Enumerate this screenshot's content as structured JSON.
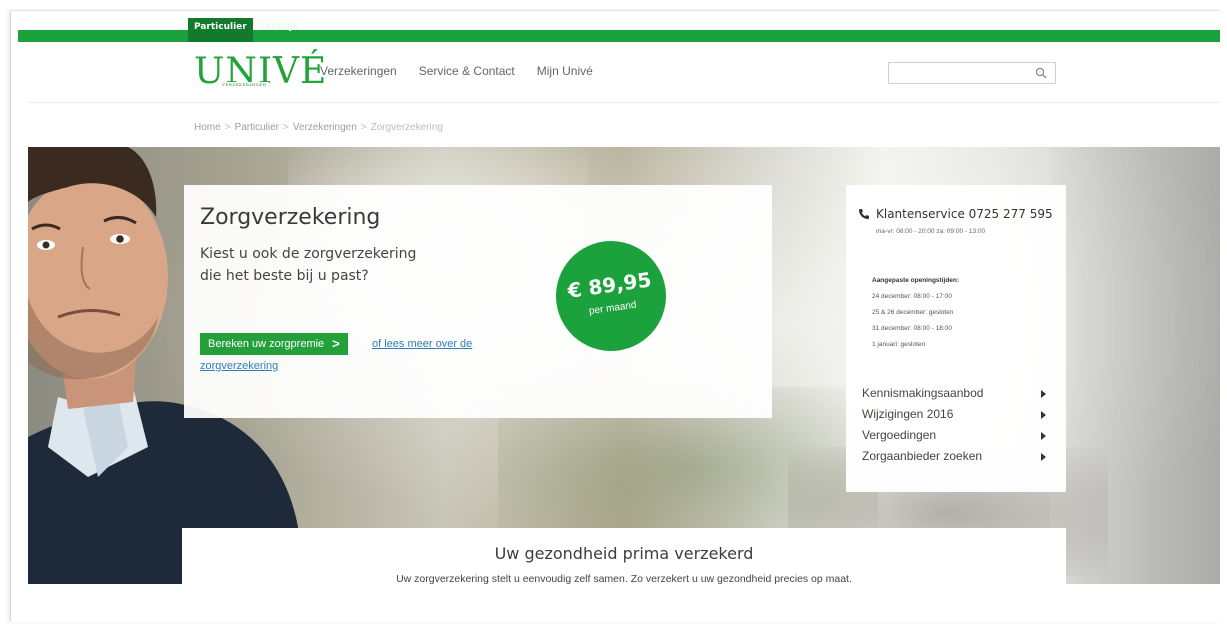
{
  "segment": {
    "active": "Particulier",
    "other": "Zakelijk"
  },
  "logo": {
    "word": "UNIVÉ",
    "sub": "VERZEKERINGEN"
  },
  "nav": [
    "Verzekeringen",
    "Service & Contact",
    "Mijn Univé"
  ],
  "search": {
    "placeholder": "",
    "icon": "search-icon"
  },
  "breadcrumb": [
    "Home",
    "Particulier",
    "Verzekeringen",
    "Zorgverzekering"
  ],
  "breadcrumb_separator": ">",
  "hero": {
    "title": "Zorgverzekering",
    "subtitle": "Kiest u ook de zorgverzekering die het beste bij u past?",
    "cta_label": "Bereken uw zorgpremie",
    "more_link": "of lees meer over de zorgverzekering",
    "price": "€ 89,95",
    "price_period": "per maand"
  },
  "service": {
    "phone_label": "Klantenservice 0725 277 595",
    "hours": "ma-vr: 08:00 - 20:00 za: 09:00 - 13:00",
    "adjusted_title": "Aangepaste openingstijden:",
    "adjusted": [
      "24 december: 08:00 - 17:00",
      "25 & 26 december: gesloten",
      "31 december: 08:00 - 18:00",
      "1 januari: gesloten"
    ],
    "links": [
      "Kennismakingsaanbod",
      "Wijzigingen 2016",
      "Vergoedingen",
      "Zorgaanbieder zoeken"
    ]
  },
  "intro": {
    "title": "Uw gezondheid prima verzekerd",
    "text": "Uw zorgverzekering stelt u eenvoudig zelf samen. Zo verzekert u uw gezondheid precies op maat."
  },
  "colors": {
    "brand_green": "#1ca23c",
    "link_blue": "#2f7fb6"
  }
}
